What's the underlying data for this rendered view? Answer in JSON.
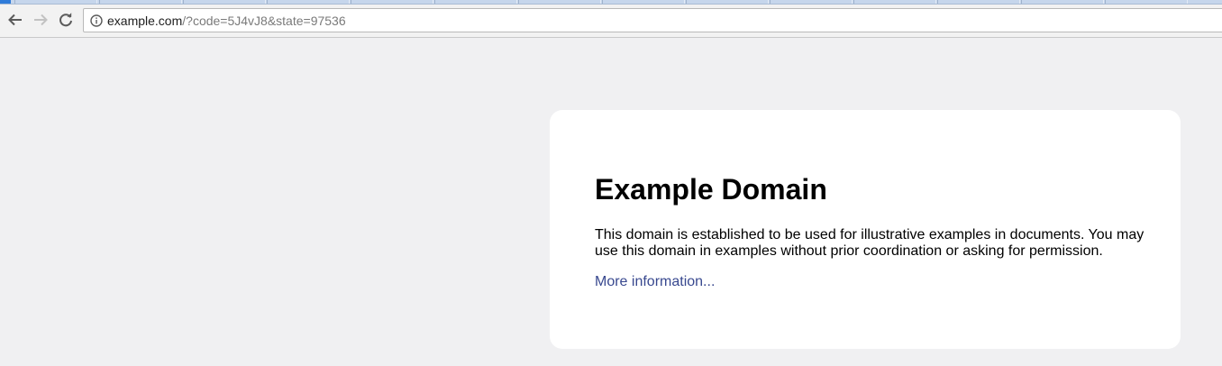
{
  "browser": {
    "address_bar": {
      "host": "example.com",
      "path": "/?code=5J4vJ8&state=97536"
    },
    "nav": {
      "back_icon": "back-arrow-icon",
      "forward_icon": "forward-arrow-icon",
      "reload_icon": "reload-icon",
      "site_info_icon": "info-icon"
    }
  },
  "page": {
    "title": "Example Domain",
    "description": "This domain is established to be used for illustrative examples in documents. You may use this domain in examples without prior coordination or asking for permission.",
    "more_link": "More information..."
  },
  "colors": {
    "page_background": "#f0f0f2",
    "card_background": "#ffffff",
    "link": "#38488f"
  }
}
